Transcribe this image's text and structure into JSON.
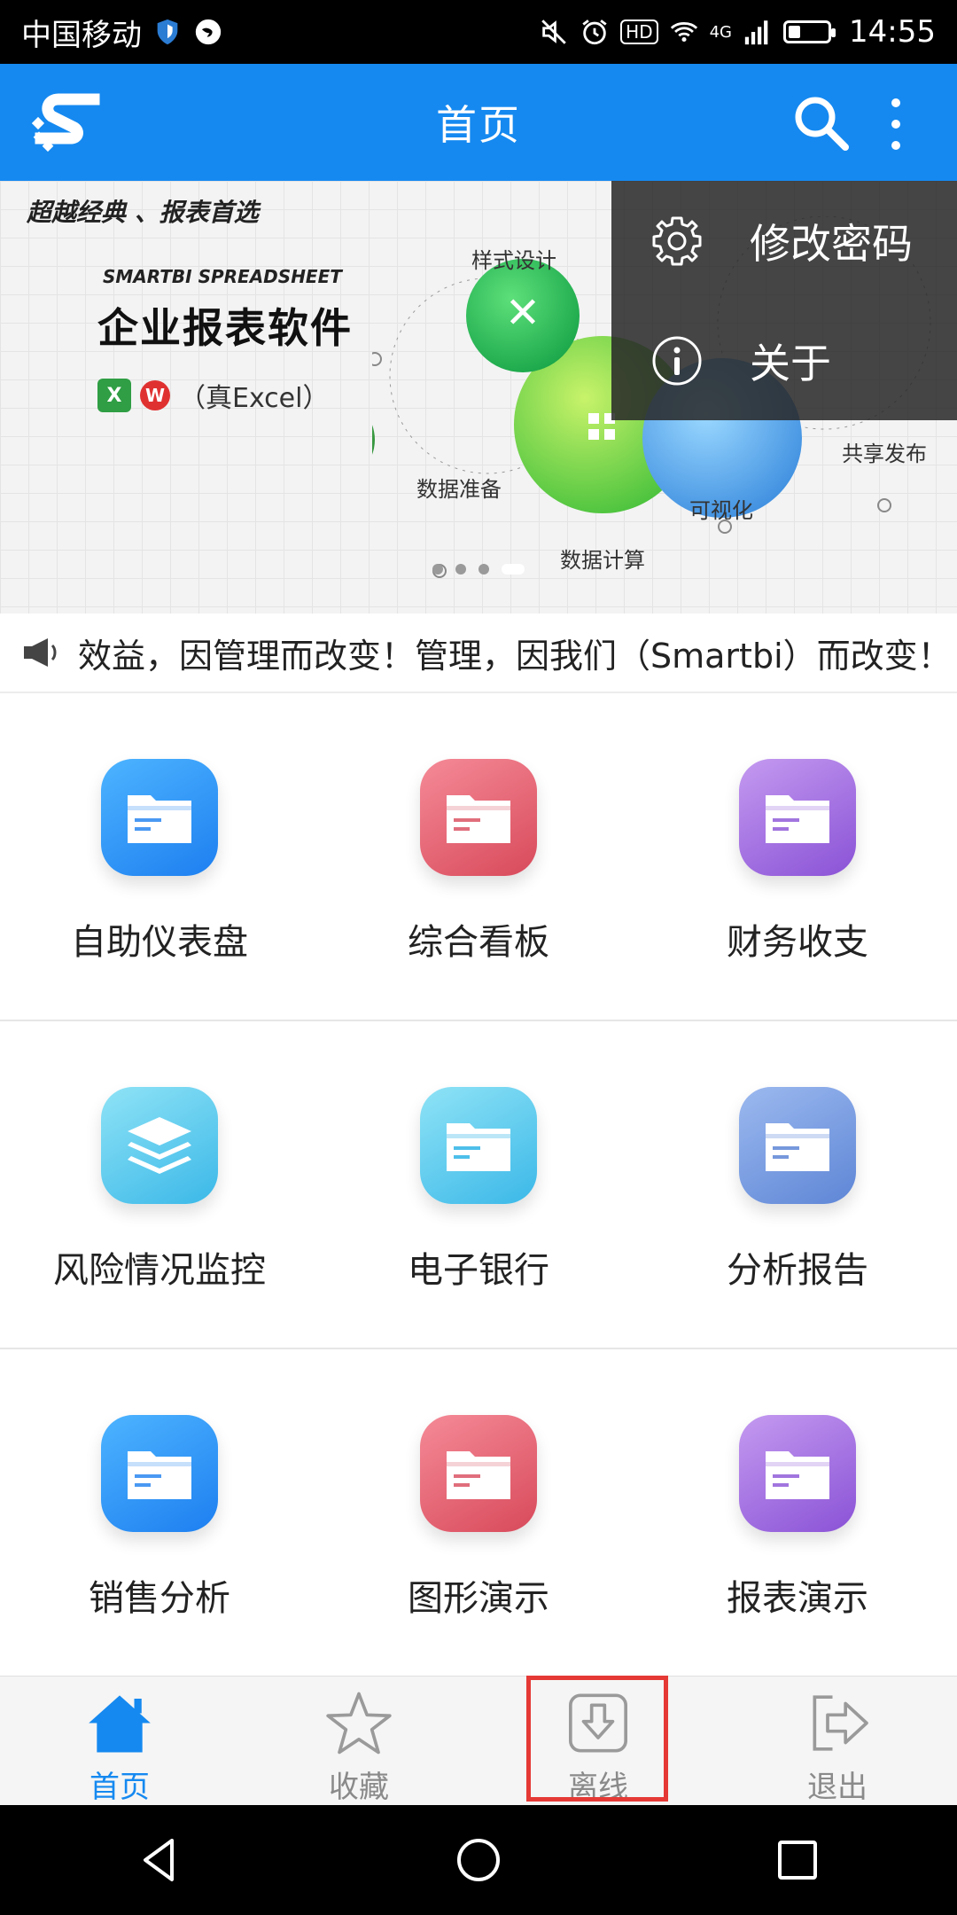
{
  "status_bar": {
    "carrier": "中国移动",
    "network_badge": "HD",
    "network_type": "4G",
    "time": "14:55",
    "battery_level": 0.28
  },
  "app_bar": {
    "title": "首页",
    "logo_icon": "smartbi-logo-icon",
    "search_icon": "search-icon",
    "more_icon": "more-vertical-icon"
  },
  "banner": {
    "slogan": "超越经典 、报表首选",
    "brand": "SMARTBI SPREADSHEET",
    "heading": "企业报表软件",
    "excel_text": "（真Excel）",
    "excel_icon_letter": "X",
    "wps_icon_letter": "W",
    "labels": {
      "style_design": "样式设计",
      "data_prep": "数据准备",
      "data_calc": "数据计算",
      "visualize": "可视化",
      "share_publish": "共享发布"
    },
    "slide_count": 4,
    "active_slide": 4
  },
  "popup_menu": {
    "items": [
      {
        "label": "修改密码",
        "icon": "gear-icon"
      },
      {
        "label": "关于",
        "icon": "info-icon"
      }
    ]
  },
  "notice": {
    "icon": "megaphone-icon",
    "text": "效益，因管理而改变！管理，因我们（Smartbi）而改变！"
  },
  "grid": {
    "tiles": [
      {
        "label": "自助仪表盘",
        "color": "#1d7ff0",
        "icon": "folder-icon"
      },
      {
        "label": "综合看板",
        "color": "#d84a5b",
        "icon": "folder-icon"
      },
      {
        "label": "财务收支",
        "color": "#8a52d6",
        "icon": "folder-icon"
      },
      {
        "label": "风险情况监控",
        "color": "#3bb8e8",
        "icon": "layers-icon"
      },
      {
        "label": "电子银行",
        "color": "#3bb8e8",
        "icon": "folder-icon"
      },
      {
        "label": "分析报告",
        "color": "#5e86d6",
        "icon": "folder-icon"
      },
      {
        "label": "销售分析",
        "color": "#1d7ff0",
        "icon": "folder-icon"
      },
      {
        "label": "图形演示",
        "color": "#d84a5b",
        "icon": "folder-icon"
      },
      {
        "label": "报表演示",
        "color": "#8a52d6",
        "icon": "folder-icon"
      }
    ]
  },
  "bottom_nav": {
    "items": [
      {
        "label": "首页",
        "icon": "home-icon",
        "active": true
      },
      {
        "label": "收藏",
        "icon": "star-icon",
        "active": false
      },
      {
        "label": "离线",
        "icon": "download-icon",
        "active": false
      },
      {
        "label": "退出",
        "icon": "exit-icon",
        "active": false
      }
    ],
    "highlighted_item": "离线"
  },
  "colors": {
    "primary": "#1589F0",
    "highlight_border": "#e53935"
  }
}
